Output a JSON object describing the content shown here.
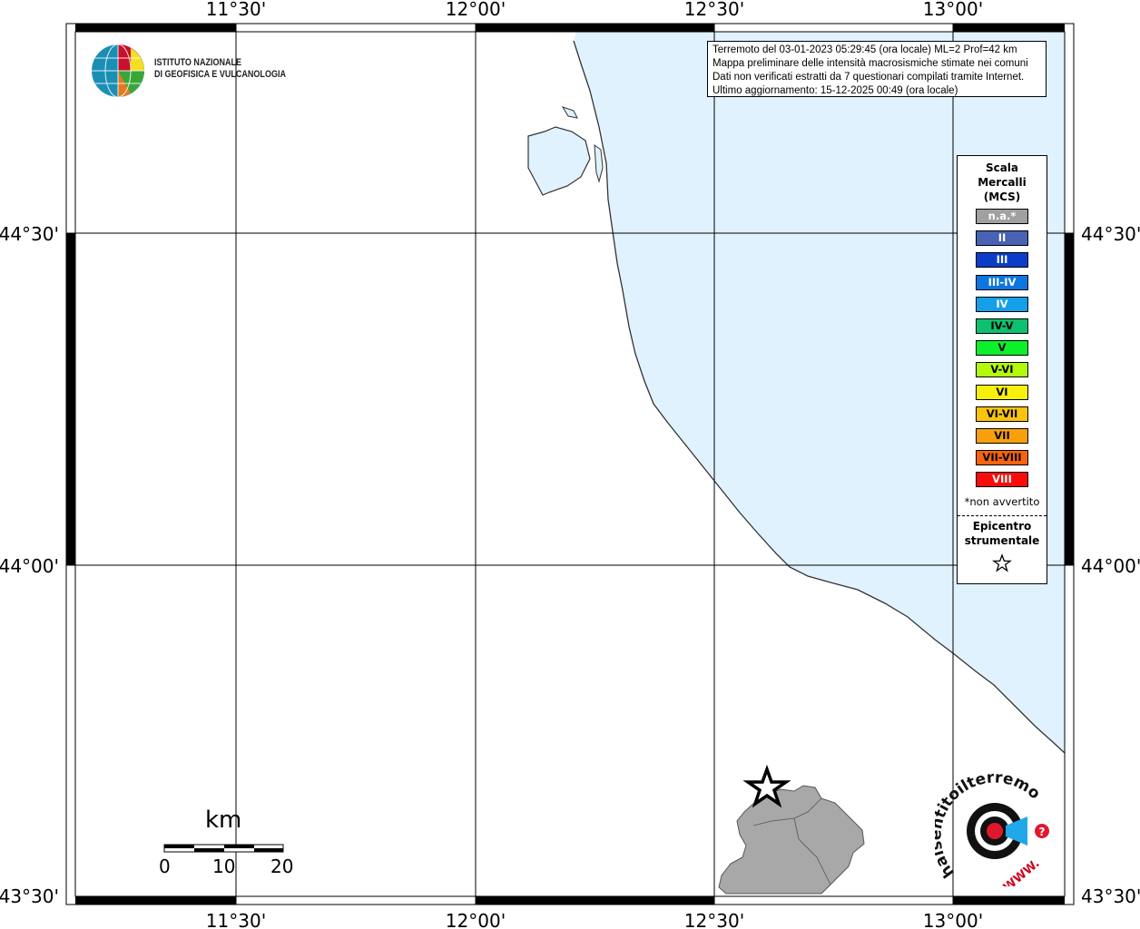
{
  "map": {
    "lon_ticks": [
      "11°30'",
      "12°00'",
      "12°30'",
      "13°00'"
    ],
    "lat_ticks": [
      "44°30'",
      "44°00'",
      "43°30'"
    ],
    "sea_color": "#e0f2fd",
    "land_color": "#ffffff",
    "province_color": "#a8a8a8"
  },
  "info": {
    "line1": "Terremoto del 03-01-2023 05:29:45 (ora locale) ML=2 Prof=42 km",
    "line2": "Mappa preliminare delle intensità macrosismiche stimate nei comuni",
    "line3": "Dati non verificati estratti da 7 questionari compilati tramite Internet.",
    "line4": "Ultimo aggiornamento: 15-12-2025 00:49 (ora locale)"
  },
  "legend": {
    "title1": "Scala",
    "title2": "Mercalli",
    "title3": "(MCS)",
    "items": [
      {
        "label": "n.a.*",
        "color": "#a0a0a0",
        "text_color": "#ffffff"
      },
      {
        "label": "II",
        "color": "#4a62b4",
        "text_color": "#ffffff"
      },
      {
        "label": "III",
        "color": "#0a3ec8",
        "text_color": "#ffffff"
      },
      {
        "label": "III-IV",
        "color": "#0c76e0",
        "text_color": "#ffffff"
      },
      {
        "label": "IV",
        "color": "#14a0e8",
        "text_color": "#ffffff"
      },
      {
        "label": "IV-V",
        "color": "#0cc070",
        "text_color": "#000000"
      },
      {
        "label": "V",
        "color": "#0cf02c",
        "text_color": "#000000"
      },
      {
        "label": "V-VI",
        "color": "#b4f80c",
        "text_color": "#000000"
      },
      {
        "label": "VI",
        "color": "#f8f00c",
        "text_color": "#000000"
      },
      {
        "label": "VI-VII",
        "color": "#f8c40c",
        "text_color": "#000000"
      },
      {
        "label": "VII",
        "color": "#f8a00c",
        "text_color": "#000000"
      },
      {
        "label": "VII-VIII",
        "color": "#f8640c",
        "text_color": "#000000"
      },
      {
        "label": "VIII",
        "color": "#f80c0c",
        "text_color": "#ffffff"
      }
    ],
    "note": "*non avvertito",
    "epi1": "Epicentro",
    "epi2": "strumentale"
  },
  "logo": {
    "line1": "ISTITUTO NAZIONALE",
    "line2": "DI GEOFISICA E VULCANOLOGIA"
  },
  "scalebar": {
    "unit": "km",
    "labels": [
      "0",
      "10",
      "20"
    ]
  },
  "hai_logo": {
    "text": "haisentitoilterremoto.it",
    "url": "WWW."
  }
}
